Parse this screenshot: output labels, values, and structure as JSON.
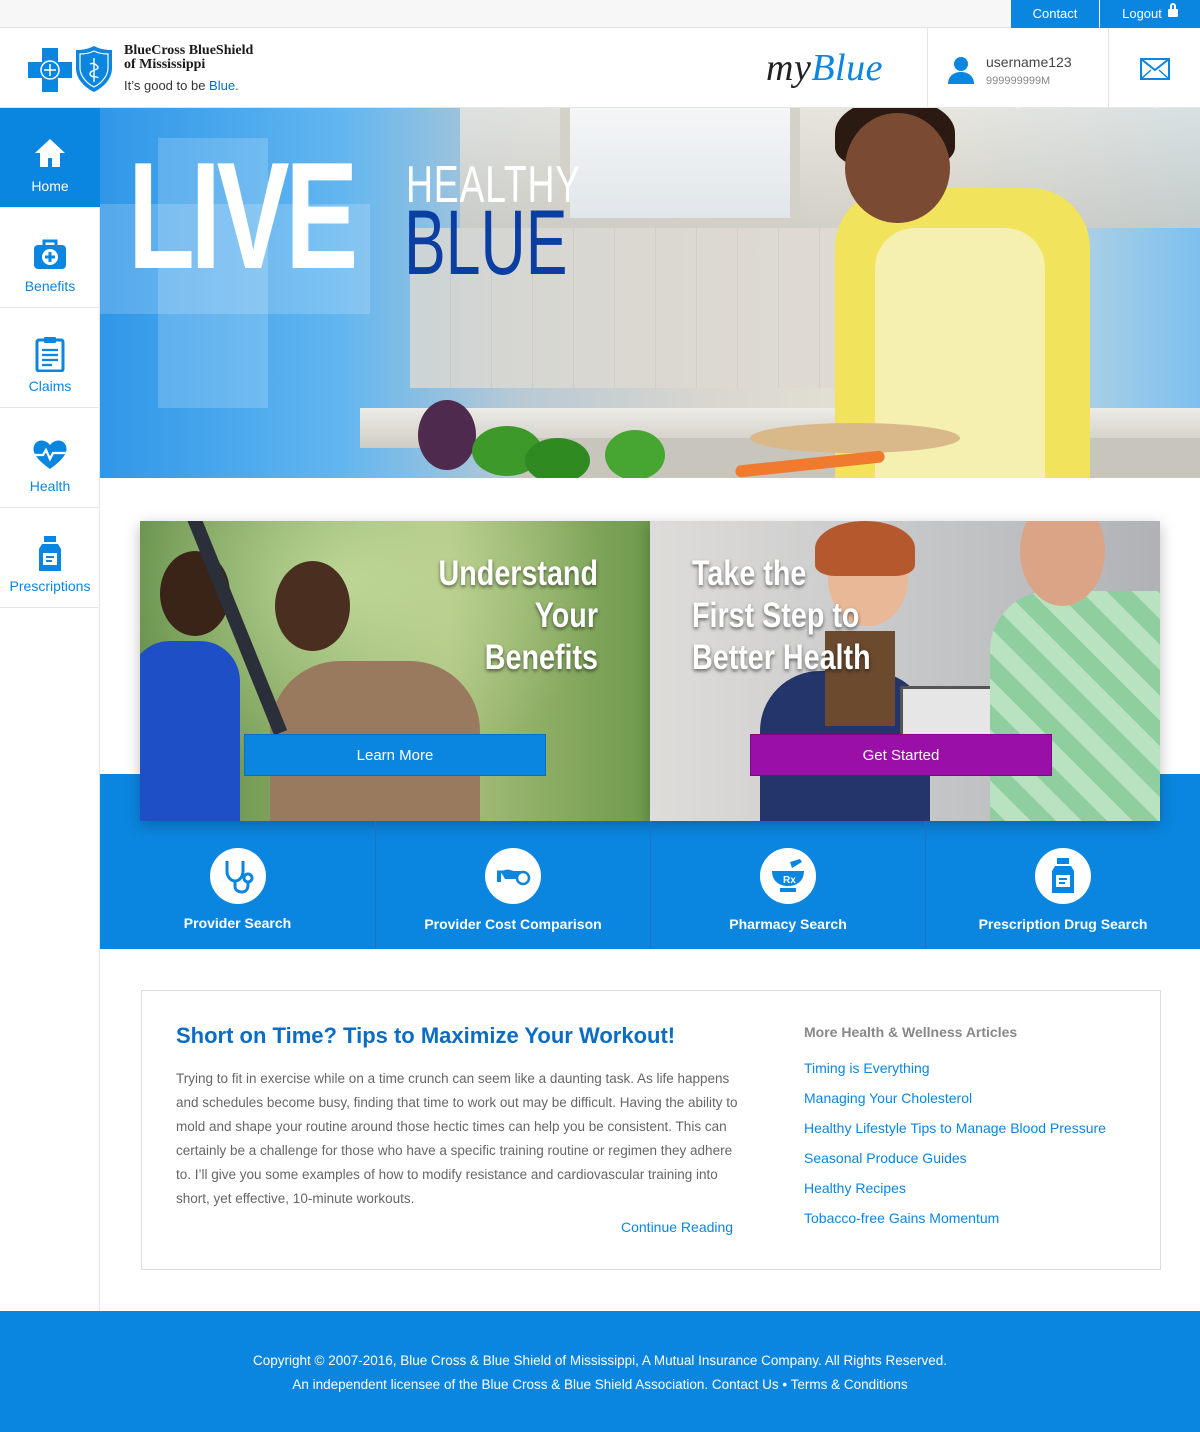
{
  "topbar": {
    "contact": "Contact",
    "logout": "Logout"
  },
  "brand": {
    "name_line1": "BlueCross BlueShield",
    "name_line2": "of Mississippi",
    "tagline_prefix": "It’s good to be ",
    "tagline_highlight": "Blue.",
    "app_my": "my",
    "app_blue": "Blue"
  },
  "user": {
    "username": "username123",
    "member_id": "999999999M"
  },
  "sidebar": {
    "items": [
      {
        "label": "Home",
        "icon": "home-icon",
        "active": true
      },
      {
        "label": "Benefits",
        "icon": "medical-kit-icon"
      },
      {
        "label": "Claims",
        "icon": "clipboard-icon"
      },
      {
        "label": "Health",
        "icon": "heartbeat-icon"
      },
      {
        "label": "Prescriptions",
        "icon": "pill-bottle-icon"
      }
    ]
  },
  "hero": {
    "word1": "LIVE",
    "word2": "HEALTHY",
    "word3": "BLUE"
  },
  "promos": [
    {
      "title_lines": [
        "Understand",
        "Your",
        "Benefits"
      ],
      "button": "Learn More",
      "button_color": "#0b86e0"
    },
    {
      "title_lines": [
        "Take the",
        "First Step to",
        "Better Health"
      ],
      "button": "Get Started",
      "button_color": "#9a0fa8"
    }
  ],
  "tools": [
    {
      "label": "Provider Search",
      "icon": "stethoscope-icon"
    },
    {
      "label": "Provider Cost Comparison",
      "icon": "hand-coin-icon"
    },
    {
      "label": "Pharmacy Search",
      "icon": "mortar-pestle-rx-icon"
    },
    {
      "label": "Prescription Drug Search",
      "icon": "pill-bottle-icon"
    }
  ],
  "article": {
    "title": "Short on Time? Tips to Maximize Your Workout!",
    "body": "Trying to fit in exercise while on a time crunch can seem like a daunting task. As life happens and schedules become busy, finding that time to work out may be difficult. Having the ability to mold and shape your routine around those hectic times can help you be consistent. This can certainly be a challenge for those who have a specific training routine or regimen they adhere to. I’ll give you some examples of how to modify resistance and cardiovascular training into short, yet effective, 10-minute workouts.",
    "continue": "Continue Reading",
    "more_heading": "More Health & Wellness Articles",
    "links": [
      "Timing is Everything",
      "Managing Your Cholesterol",
      "Healthy Lifestyle Tips to Manage Blood Pressure",
      "Seasonal Produce Guides",
      "Healthy Recipes",
      "Tobacco-free Gains Momentum"
    ]
  },
  "footer": {
    "line1": "Copyright © 2007-2016, Blue Cross & Blue Shield of Mississippi, A Mutual Insurance Company. All Rights Reserved.",
    "line2_prefix": "An independent licensee of the Blue Cross & Blue Shield Association. ",
    "contact": "Contact Us",
    "separator": " • ",
    "terms": "Terms & Conditions"
  },
  "colors": {
    "primary": "#0b86e0",
    "brand_dark_blue": "#0a3ea3",
    "purple": "#9a0fa8",
    "link": "#0b6cc4"
  }
}
